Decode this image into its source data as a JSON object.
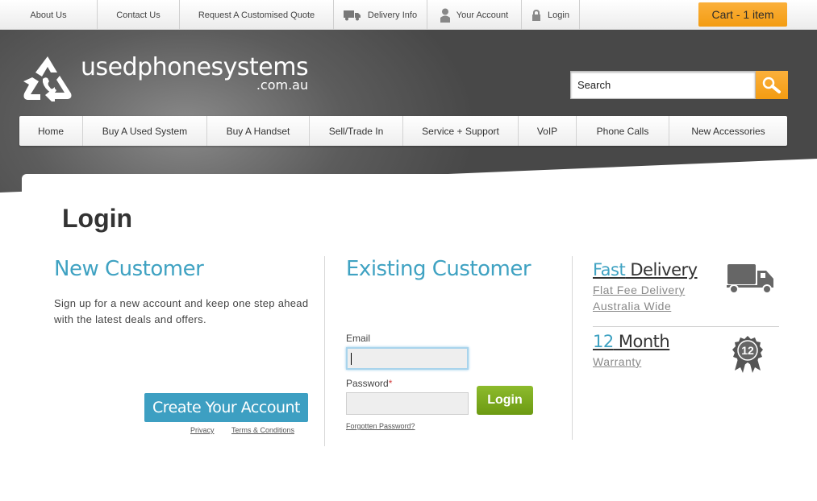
{
  "topbar": {
    "links": [
      "About Us",
      "Contact Us",
      "Request A Customised Quote",
      "Delivery Info",
      "Your Account",
      "Login"
    ],
    "cart_label": "Cart - 1 item"
  },
  "brand": {
    "name": "usedphonesystems",
    "domain": ".com.au"
  },
  "search": {
    "value": "Search"
  },
  "nav": {
    "items": [
      "Home",
      "Buy A Used System",
      "Buy A Handset",
      "Sell/Trade In",
      "Service + Support",
      "VoIP",
      "Phone Calls",
      "New Accessories"
    ]
  },
  "page": {
    "title": "Login"
  },
  "new_customer": {
    "heading": "New Customer",
    "text": "Sign up for a new account and keep one step ahead with the latest deals and offers.",
    "create_button": "Create Your Account",
    "privacy": "Privacy",
    "terms": "Terms & Conditions"
  },
  "existing_customer": {
    "heading": "Existing Customer",
    "email_label": "Email",
    "email_value": "",
    "password_label": "Password",
    "required_mark": "*",
    "password_value": "",
    "login_button": "Login",
    "forgot": "Forgotten Password?"
  },
  "features": {
    "delivery_title_hl": "Fast",
    "delivery_title_rest": " Delivery",
    "delivery_line1": "Flat Fee Delivery",
    "delivery_line2": "Australia Wide",
    "warranty_title_hl": "12",
    "warranty_title_rest": " Month",
    "warranty_sub": "Warranty",
    "badge_number": "12"
  },
  "colors": {
    "accent_blue": "#3fa2c2",
    "cart_orange": "#f7a21b",
    "login_green": "#7aab1f"
  }
}
